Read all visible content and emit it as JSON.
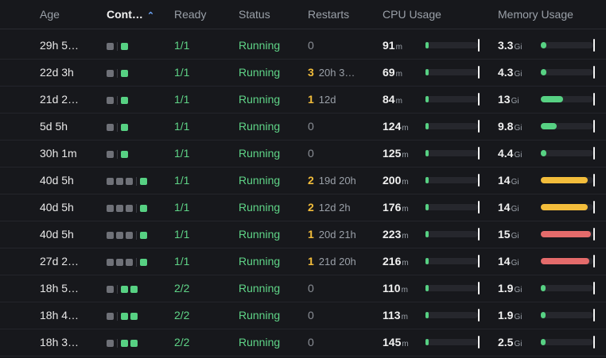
{
  "header": {
    "age": "Age",
    "containers": "Cont…",
    "ready": "Ready",
    "status": "Status",
    "restarts": "Restarts",
    "cpu": "CPU Usage",
    "memory": "Memory Usage"
  },
  "colors": {
    "ok": "#57d183",
    "warn": "#f3bd3b",
    "crit": "#e46b6b",
    "low": "#57d183"
  },
  "rows": [
    {
      "age": "29h 5…",
      "cont": {
        "before": 1,
        "after": 1
      },
      "ready": "1/1",
      "status": "Running",
      "restarts": "0",
      "restart_ago": "",
      "cpu": "91",
      "cpu_unit": "m",
      "cpu_frac": 0.03,
      "mem": "3.3",
      "mem_unit": "Gi",
      "mem_frac": 0.1,
      "mem_level": "low"
    },
    {
      "age": "22d 3h",
      "cont": {
        "before": 1,
        "after": 1
      },
      "ready": "1/1",
      "status": "Running",
      "restarts": "3",
      "restart_ago": "20h 3…",
      "cpu": "69",
      "cpu_unit": "m",
      "cpu_frac": 0.03,
      "mem": "4.3",
      "mem_unit": "Gi",
      "mem_frac": 0.1,
      "mem_level": "low"
    },
    {
      "age": "21d 2…",
      "cont": {
        "before": 1,
        "after": 1
      },
      "ready": "1/1",
      "status": "Running",
      "restarts": "1",
      "restart_ago": "12d",
      "cpu": "84",
      "cpu_unit": "m",
      "cpu_frac": 0.03,
      "mem": "13",
      "mem_unit": "Gi",
      "mem_frac": 0.42,
      "mem_level": "low"
    },
    {
      "age": "5d 5h",
      "cont": {
        "before": 1,
        "after": 1
      },
      "ready": "1/1",
      "status": "Running",
      "restarts": "0",
      "restart_ago": "",
      "cpu": "124",
      "cpu_unit": "m",
      "cpu_frac": 0.03,
      "mem": "9.8",
      "mem_unit": "Gi",
      "mem_frac": 0.3,
      "mem_level": "low"
    },
    {
      "age": "30h 1m",
      "cont": {
        "before": 1,
        "after": 1
      },
      "ready": "1/1",
      "status": "Running",
      "restarts": "0",
      "restart_ago": "",
      "cpu": "125",
      "cpu_unit": "m",
      "cpu_frac": 0.03,
      "mem": "4.4",
      "mem_unit": "Gi",
      "mem_frac": 0.1,
      "mem_level": "low"
    },
    {
      "age": "40d 5h",
      "cont": {
        "before": 3,
        "after": 1
      },
      "ready": "1/1",
      "status": "Running",
      "restarts": "2",
      "restart_ago": "19d 20h",
      "cpu": "200",
      "cpu_unit": "m",
      "cpu_frac": 0.03,
      "mem": "14",
      "mem_unit": "Gi",
      "mem_frac": 0.9,
      "mem_level": "warn"
    },
    {
      "age": "40d 5h",
      "cont": {
        "before": 3,
        "after": 1
      },
      "ready": "1/1",
      "status": "Running",
      "restarts": "2",
      "restart_ago": "12d 2h",
      "cpu": "176",
      "cpu_unit": "m",
      "cpu_frac": 0.03,
      "mem": "14",
      "mem_unit": "Gi",
      "mem_frac": 0.9,
      "mem_level": "warn"
    },
    {
      "age": "40d 5h",
      "cont": {
        "before": 3,
        "after": 1
      },
      "ready": "1/1",
      "status": "Running",
      "restarts": "1",
      "restart_ago": "20d 21h",
      "cpu": "223",
      "cpu_unit": "m",
      "cpu_frac": 0.03,
      "mem": "15",
      "mem_unit": "Gi",
      "mem_frac": 0.95,
      "mem_level": "crit"
    },
    {
      "age": "27d 2…",
      "cont": {
        "before": 3,
        "after": 1
      },
      "ready": "1/1",
      "status": "Running",
      "restarts": "1",
      "restart_ago": "21d 20h",
      "cpu": "216",
      "cpu_unit": "m",
      "cpu_frac": 0.03,
      "mem": "14",
      "mem_unit": "Gi",
      "mem_frac": 0.93,
      "mem_level": "crit"
    },
    {
      "age": "18h 5…",
      "cont": {
        "before": 1,
        "after": 2
      },
      "ready": "2/2",
      "status": "Running",
      "restarts": "0",
      "restart_ago": "",
      "cpu": "110",
      "cpu_unit": "m",
      "cpu_frac": 0.03,
      "mem": "1.9",
      "mem_unit": "Gi",
      "mem_frac": 0.05,
      "mem_level": "low"
    },
    {
      "age": "18h 4…",
      "cont": {
        "before": 1,
        "after": 2
      },
      "ready": "2/2",
      "status": "Running",
      "restarts": "0",
      "restart_ago": "",
      "cpu": "113",
      "cpu_unit": "m",
      "cpu_frac": 0.03,
      "mem": "1.9",
      "mem_unit": "Gi",
      "mem_frac": 0.05,
      "mem_level": "low"
    },
    {
      "age": "18h 3…",
      "cont": {
        "before": 1,
        "after": 2
      },
      "ready": "2/2",
      "status": "Running",
      "restarts": "0",
      "restart_ago": "",
      "cpu": "145",
      "cpu_unit": "m",
      "cpu_frac": 0.03,
      "mem": "2.5",
      "mem_unit": "Gi",
      "mem_frac": 0.07,
      "mem_level": "low"
    }
  ]
}
